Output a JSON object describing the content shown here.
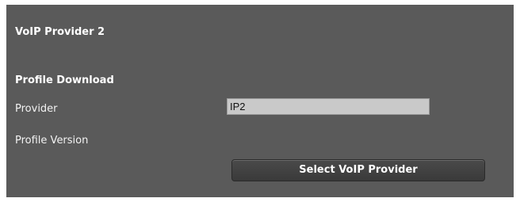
{
  "panel": {
    "title": "VoIP Provider 2",
    "section": "Profile Download"
  },
  "fields": {
    "provider_label": "Provider",
    "provider_value": "IP2",
    "profile_version_label": "Profile Version"
  },
  "actions": {
    "select_provider_label": "Select VoIP Provider"
  },
  "colors": {
    "panel_bg": "#5a5a5a",
    "field_bg": "#c9c9c9",
    "button_bg": "#3f3f3f"
  }
}
